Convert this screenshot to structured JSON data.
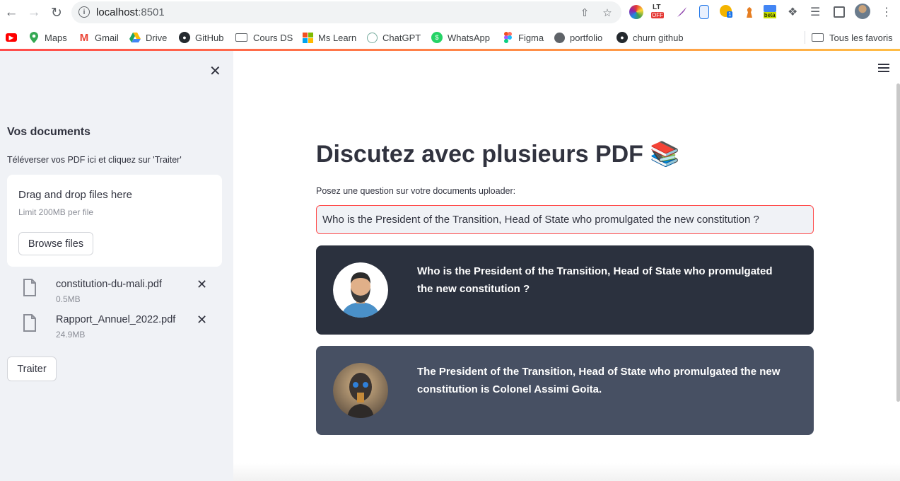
{
  "browser": {
    "url_host": "localhost",
    "url_port": ":8501"
  },
  "bookmarks": [
    {
      "label": "Maps",
      "icon": "maps-icon"
    },
    {
      "label": "Gmail",
      "icon": "gmail-icon"
    },
    {
      "label": "Drive",
      "icon": "drive-icon"
    },
    {
      "label": "GitHub",
      "icon": "github-icon"
    },
    {
      "label": "Cours DS",
      "icon": "folder-icon"
    },
    {
      "label": "Ms Learn",
      "icon": "microsoft-icon"
    },
    {
      "label": "ChatGPT",
      "icon": "chatgpt-icon"
    },
    {
      "label": "WhatsApp",
      "icon": "whatsapp-icon"
    },
    {
      "label": "Figma",
      "icon": "figma-icon"
    },
    {
      "label": "portfolio",
      "icon": "globe-icon"
    },
    {
      "label": "churn github",
      "icon": "github-icon"
    }
  ],
  "all_bookmarks_label": "Tous les favoris",
  "extensions": {
    "lt_badge": "LT",
    "lt_off": "OFF",
    "count_badge": "1",
    "beta_badge": "beta"
  },
  "sidebar": {
    "title": "Vos documents",
    "subtitle": "Téléverser vos PDF ici et cliquez sur 'Traiter'",
    "dropzone_title": "Drag and drop files here",
    "dropzone_limit": "Limit 200MB per file",
    "browse_label": "Browse files",
    "files": [
      {
        "name": "constitution-du-mali.pdf",
        "size": "0.5MB"
      },
      {
        "name": "Rapport_Annuel_2022.pdf",
        "size": "24.9MB"
      }
    ],
    "process_label": "Traiter"
  },
  "main": {
    "title": "Discutez avec plusieurs PDF 📚",
    "question_label": "Posez une question sur votre documents uploader:",
    "question_value": "Who is the President of the Transition, Head of State who promulgated the new constitution ?",
    "messages": [
      {
        "role": "user",
        "text": "Who is the President of the Transition, Head of State who promulgated the new constitution ?"
      },
      {
        "role": "bot",
        "text": "The President of the Transition, Head of State who promulgated the new constitution is Colonel Assimi Goita."
      }
    ]
  },
  "colors": {
    "accent": "#ff4b4b",
    "sidebar_bg": "#f0f2f6",
    "user_msg_bg": "#2b313e",
    "bot_msg_bg": "#475063"
  }
}
